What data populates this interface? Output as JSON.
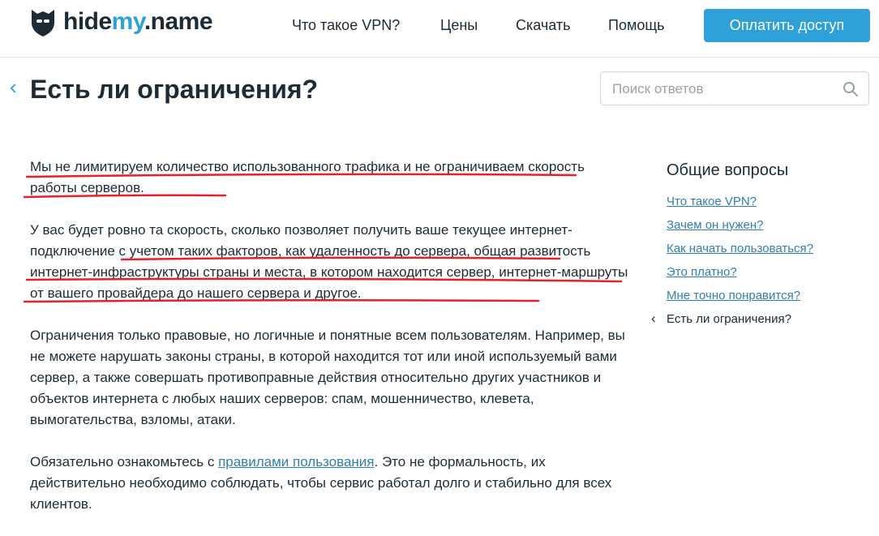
{
  "header": {
    "logo": {
      "name_part1": "hide",
      "name_part2": "my",
      "name_part3": ".name"
    },
    "nav": [
      "Что такое VPN?",
      "Цены",
      "Скачать",
      "Помощь"
    ],
    "cta_label": "Оплатить доступ"
  },
  "page": {
    "title": "Есть ли ограничения?",
    "search_placeholder": "Поиск ответов"
  },
  "article": {
    "p1": "Мы не лимитируем количество использованного трафика и не ограничиваем скорость работы серверов.",
    "p2": "У вас будет ровно та скорость, сколько позволяет получить ваше текущее интернет-подключение с учетом таких факторов, как удаленность до сервера, общая развитость интернет-инфраструктуры страны и места, в котором находится сервер, интернет-маршруты от вашего провайдера до нашего сервера и другое.",
    "p3": "Ограничения только правовые, но логичные и понятные всем пользователям. Например, вы не можете нарушать законы страны, в которой находится тот или иной используемый вами сервер, а также совершать противоправные действия относительно других участников и объектов интернета с любых наших серверов: спам, мошенничество, клевета, вымогательства, взломы, атаки.",
    "p4_before": "Обязательно ознакомьтесь с ",
    "p4_link": "правилами пользования",
    "p4_after": ". Это не формальность, их действительно необходимо соблюдать, чтобы сервис работал долго и стабильно для всех клиентов."
  },
  "sidebar": {
    "heading": "Общие вопросы",
    "links": [
      "Что такое VPN?",
      "Зачем он нужен?",
      "Как начать пользоваться?",
      "Это платно?",
      "Мне точно понравится?"
    ],
    "active": "Есть ли ограничения?"
  },
  "colors": {
    "accent": "#2ea1d9",
    "link": "#2f7fb3",
    "annotation": "#e8202a",
    "text": "#1d2b36"
  }
}
